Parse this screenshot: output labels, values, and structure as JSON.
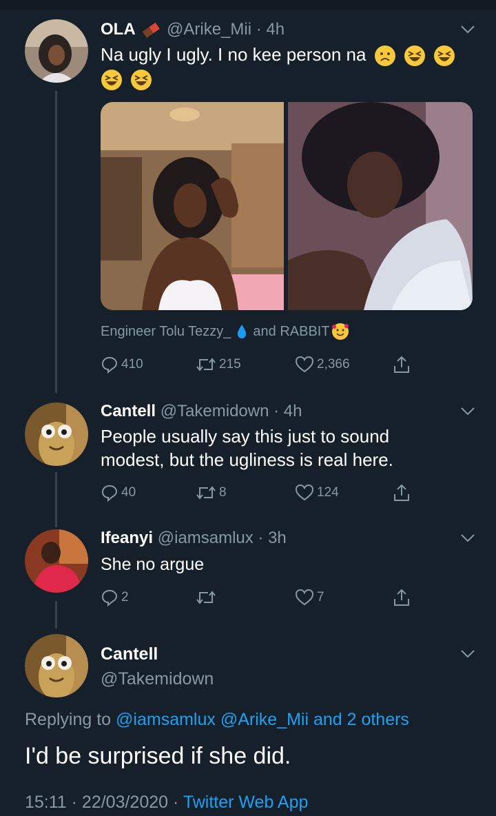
{
  "tweets": [
    {
      "name": "OLA",
      "handle": "@Arike_Mii · 4h",
      "text": "Na ugly I ugly. I no kee person na",
      "emojis": [
        "frowning-face-icon",
        "grinning-squinting-face-icon"
      ],
      "tagged": "Engineer Tolu Tezzy_",
      "tagged_and": "and RABBIT",
      "actions": {
        "replies": "410",
        "retweets": "215",
        "likes": "2,366"
      }
    },
    {
      "name": "Cantell",
      "handle": "@Takemidown · 4h",
      "text_line1": "People usually say this just to sound",
      "text_line2": "modest, but the ugliness is real here.",
      "actions": {
        "replies": "40",
        "retweets": "8",
        "likes": "124"
      }
    },
    {
      "name": "Ifeanyi",
      "handle": "@iamsamlux · 3h",
      "text": "She no argue",
      "actions": {
        "replies": "2",
        "retweets": "",
        "likes": "7"
      }
    }
  ],
  "main_tweet": {
    "name": "Cantell",
    "handle": "@Takemidown",
    "replying_prefix": "Replying to",
    "replying_links": "@iamsamlux @Arike_Mii and 2 others",
    "text": "I'd be surprised if she did.",
    "timestamp": "15:11 · 22/03/2020 ·",
    "source": "Twitter Web App"
  },
  "colors": {
    "background": "#15202b",
    "muted": "#8899a6",
    "link": "#1da1f2",
    "thread_line": "#38444d"
  }
}
